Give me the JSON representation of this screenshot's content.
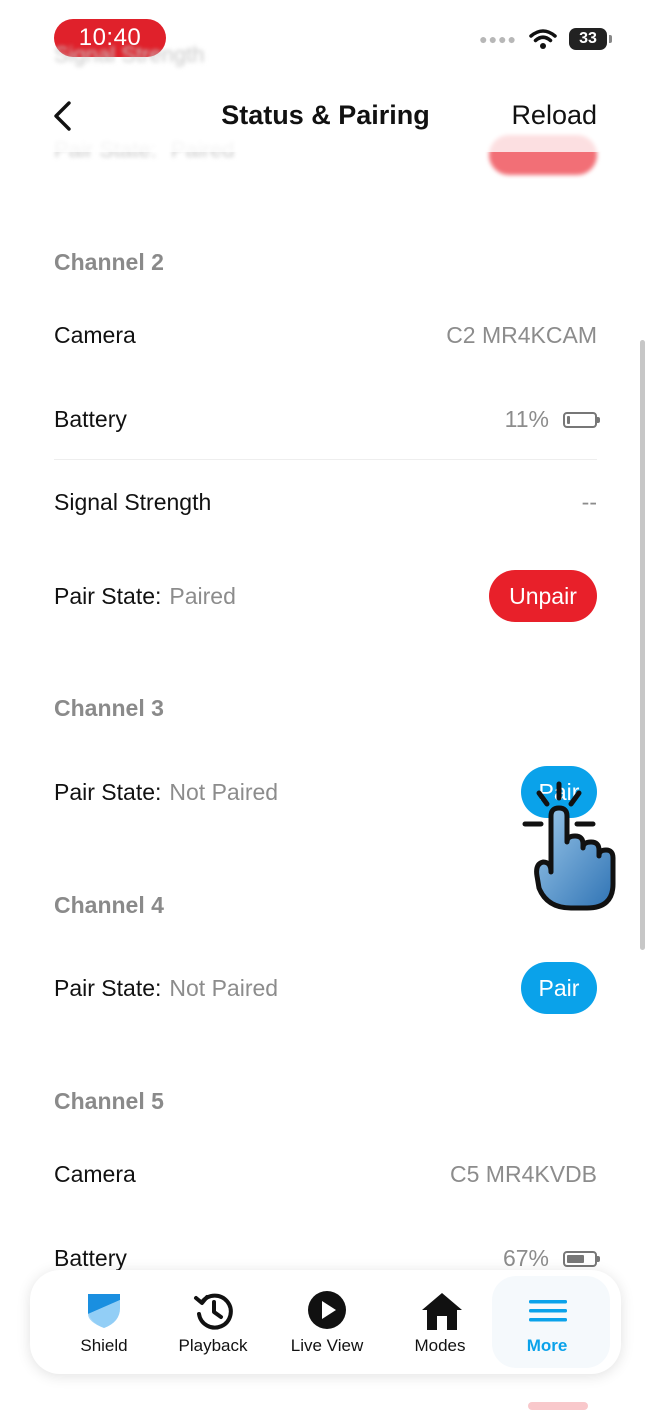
{
  "status_bar": {
    "time": "10:40",
    "battery": "33"
  },
  "ghost": {
    "signal_label": "Signal Strength",
    "pair_label": "Pair State:",
    "pair_value": "Paired",
    "unpair_label": "Unpair"
  },
  "header": {
    "title": "Status & Pairing",
    "reload_label": "Reload"
  },
  "channel2": {
    "title": "Channel 2",
    "camera_label": "Camera",
    "camera_value": "C2 MR4KCAM",
    "battery_label": "Battery",
    "battery_value": "11%",
    "battery_level": 0.11,
    "signal_label": "Signal Strength",
    "signal_value": "--",
    "pair_label": "Pair State:",
    "pair_value": "Paired",
    "button_label": "Unpair"
  },
  "channel3": {
    "title": "Channel 3",
    "pair_label": "Pair State:",
    "pair_value": "Not Paired",
    "button_label": "Pair"
  },
  "channel4": {
    "title": "Channel 4",
    "pair_label": "Pair State:",
    "pair_value": "Not Paired",
    "button_label": "Pair"
  },
  "channel5": {
    "title": "Channel 5",
    "camera_label": "Camera",
    "camera_value": "C5 MR4KVDB",
    "battery_label": "Battery",
    "battery_value": "67%",
    "battery_level": 0.67
  },
  "nav": {
    "items": [
      {
        "label": "Shield",
        "icon": "shield-icon"
      },
      {
        "label": "Playback",
        "icon": "history-icon"
      },
      {
        "label": "Live View",
        "icon": "play-icon"
      },
      {
        "label": "Modes",
        "icon": "home-icon"
      },
      {
        "label": "More",
        "icon": "menu-icon"
      }
    ],
    "active": "More"
  },
  "colors": {
    "accent": "#0aa2ea",
    "danger": "#e8202a",
    "muted": "#8c8c8c"
  }
}
